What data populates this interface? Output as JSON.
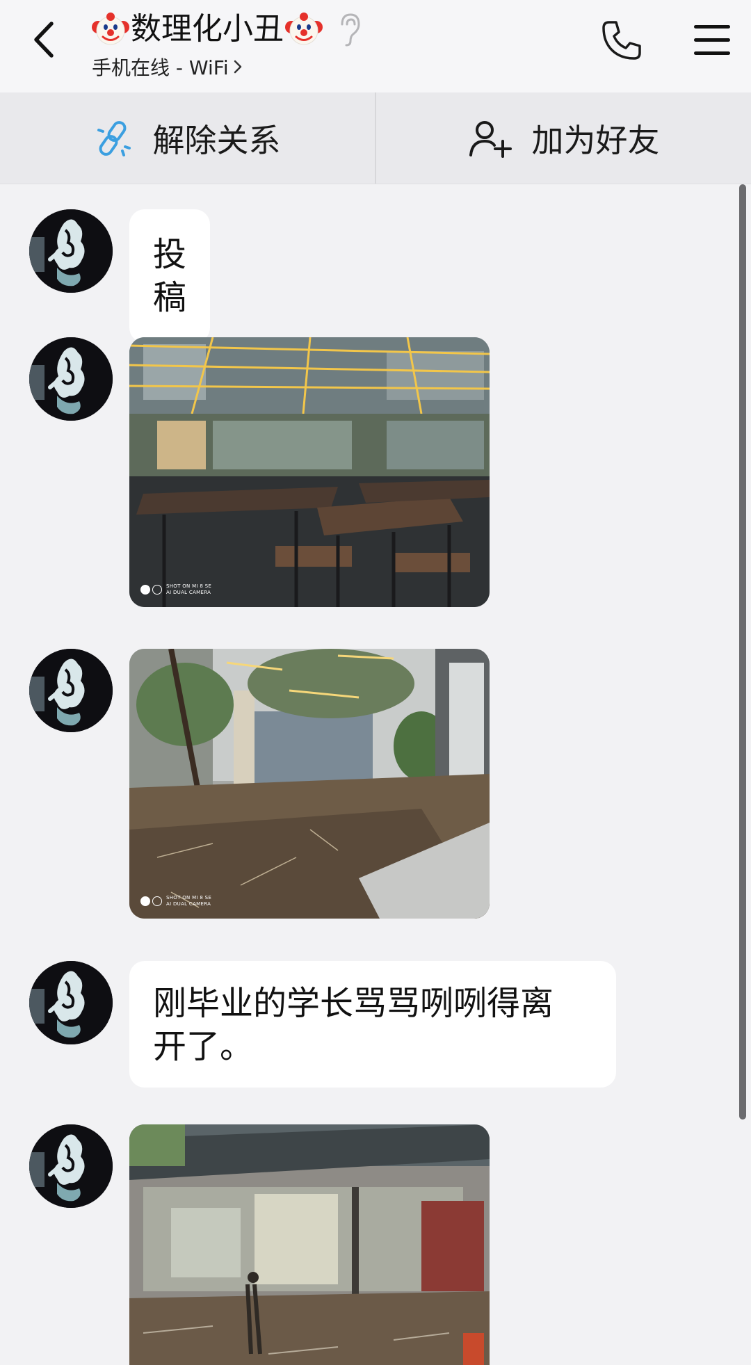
{
  "header": {
    "title": "数理化小丑",
    "subtitle": "手机在线 - WiFi",
    "title_emoji": "clown-face-icon",
    "listen_icon": "ear-icon"
  },
  "actions": {
    "unlink_label": "解除关系",
    "add_friend_label": "加为好友"
  },
  "messages": [
    {
      "type": "text",
      "text": "投稿"
    },
    {
      "type": "image",
      "watermark_line1": "SHOT ON MI 8 SE",
      "watermark_line2": "AI DUAL CAMERA"
    },
    {
      "type": "image",
      "watermark_line1": "SHOT ON MI 8 SE",
      "watermark_line2": "AI DUAL CAMERA"
    },
    {
      "type": "text",
      "text": "刚毕业的学长骂骂咧咧得离\n开了。"
    },
    {
      "type": "image"
    }
  ],
  "colors": {
    "background": "#f2f2f4",
    "bubble": "#ffffff",
    "link_icon": "#3b9fe0",
    "header": "#f6f6f8"
  }
}
